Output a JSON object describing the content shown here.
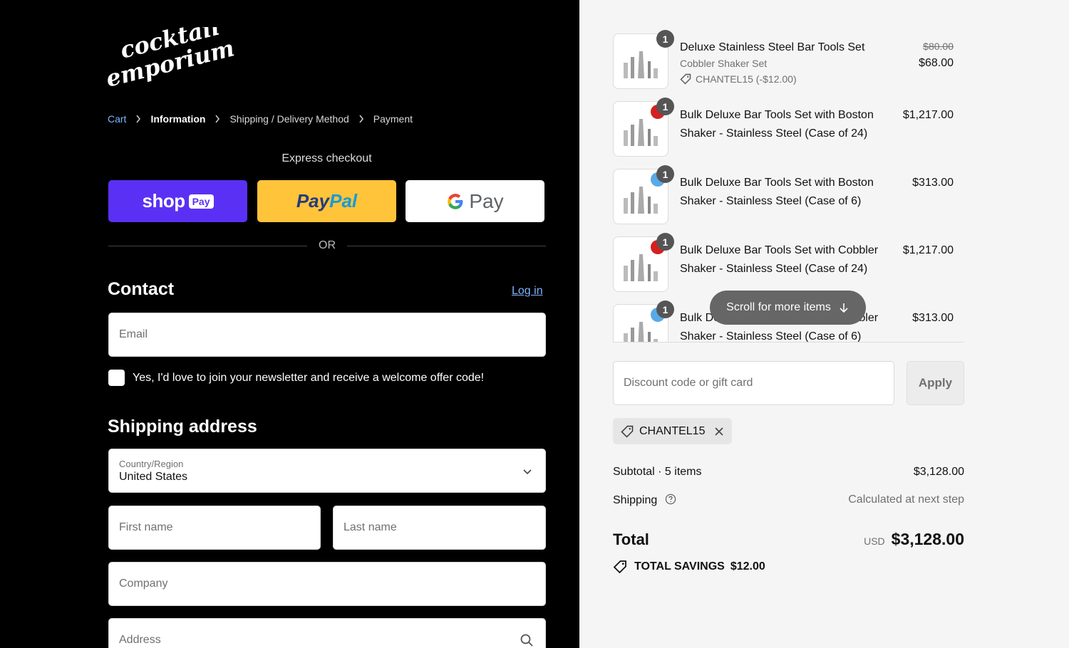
{
  "brand": {
    "logo_line1": "cocktail",
    "logo_line2": "emporium"
  },
  "breadcrumb": [
    {
      "label": "Cart",
      "state": "link"
    },
    {
      "label": "Information",
      "state": "current"
    },
    {
      "label": "Shipping / Delivery Method",
      "state": "upcoming"
    },
    {
      "label": "Payment",
      "state": "upcoming"
    }
  ],
  "express": {
    "title": "Express checkout",
    "shop_word": "shop",
    "shop_pay_badge": "Pay",
    "paypal_part1": "Pay",
    "paypal_part2": "Pal",
    "gpay_word": "Pay"
  },
  "divider_or": "OR",
  "contact": {
    "title": "Contact",
    "login_label": "Log in",
    "email_placeholder": "Email",
    "newsletter_label": "Yes, I'd love to join your newsletter and receive a welcome offer code!"
  },
  "shipping": {
    "title": "Shipping address",
    "country_label": "Country/Region",
    "country_value": "United States",
    "first_name_placeholder": "First name",
    "last_name_placeholder": "Last name",
    "company_placeholder": "Company",
    "address_placeholder": "Address"
  },
  "cart_items": [
    {
      "qty": "1",
      "name": "Deluxe Stainless Steel Bar Tools Set",
      "variant": "Cobbler Shaker Set",
      "discount": "CHANTEL15 (-$12.00)",
      "old_price": "$80.00",
      "price": "$68.00",
      "swatch": ""
    },
    {
      "qty": "1",
      "name": "Bulk Deluxe Bar Tools Set with Boston Shaker - Stainless Steel (Case of 24)",
      "price": "$1,217.00",
      "swatch": "#d42020"
    },
    {
      "qty": "1",
      "name": "Bulk Deluxe Bar Tools Set with Boston Shaker - Stainless Steel (Case of 6)",
      "price": "$313.00",
      "swatch": "#5aa9e6"
    },
    {
      "qty": "1",
      "name": "Bulk Deluxe Bar Tools Set with Cobbler Shaker - Stainless Steel (Case of 24)",
      "price": "$1,217.00",
      "swatch": "#d42020"
    },
    {
      "qty": "1",
      "name": "Bulk Deluxe Bar Tools Set with Cobbler Shaker - Stainless Steel (Case of 6)",
      "price": "$313.00",
      "swatch": "#5aa9e6"
    }
  ],
  "scroll_hint": "Scroll for more items",
  "discount": {
    "placeholder": "Discount code or gift card",
    "apply_label": "Apply",
    "applied_code": "CHANTEL15"
  },
  "summary": {
    "subtotal_label": "Subtotal · 5 items",
    "subtotal_value": "$3,128.00",
    "shipping_label": "Shipping",
    "shipping_value": "Calculated at next step",
    "total_label": "Total",
    "currency": "USD",
    "total_value": "$3,128.00",
    "savings_label": "TOTAL SAVINGS",
    "savings_value": "$12.00"
  },
  "colors": {
    "left_bg": "#000000",
    "right_bg": "#f5f5f5",
    "shop_pay": "#5a31f4",
    "paypal": "#ffc439",
    "link": "#7db4ff"
  }
}
